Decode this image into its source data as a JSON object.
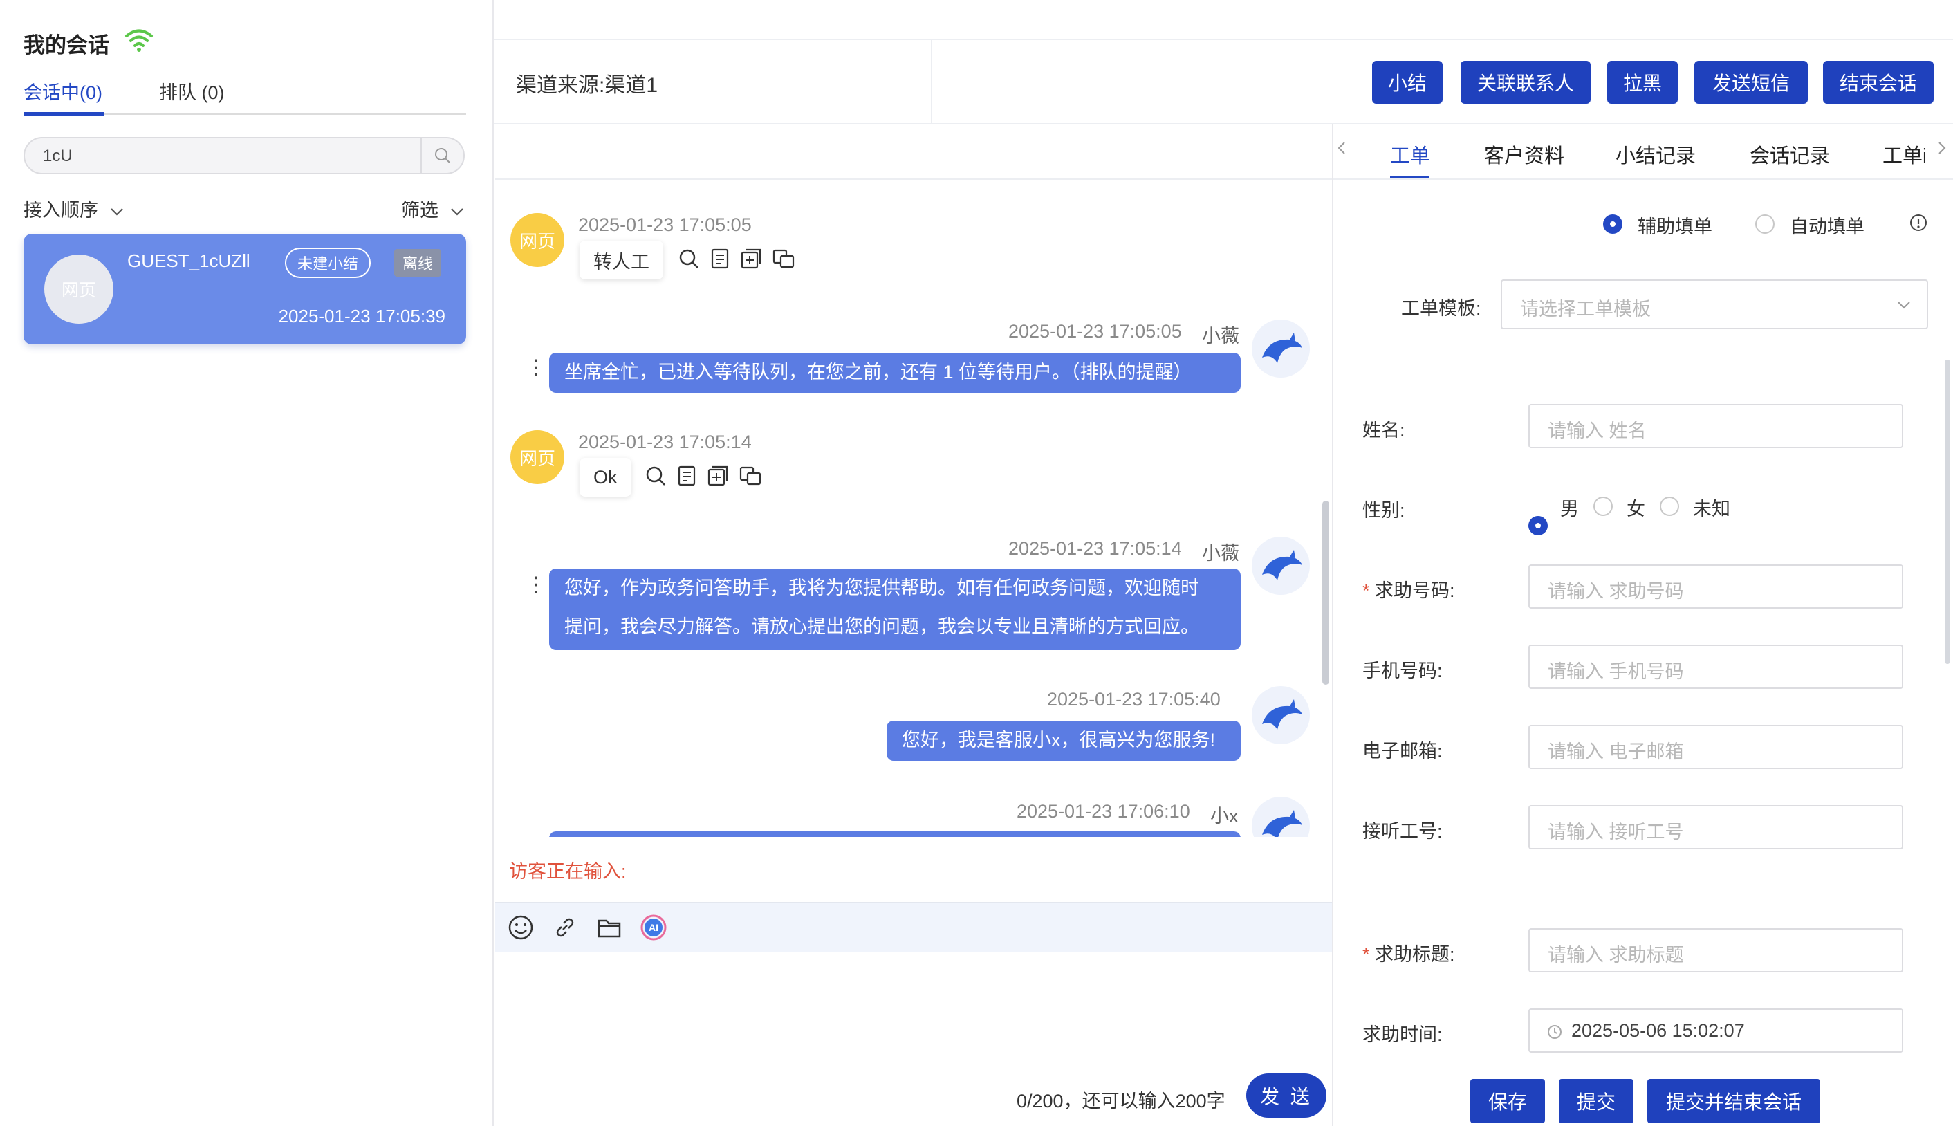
{
  "sidebar": {
    "title": "我的会话",
    "tab_active": "会话中(0)",
    "tab_queue": "排队 (0)",
    "search_value": "1cU",
    "sort_label": "接入顺序",
    "filter_label": "筛选",
    "session": {
      "avatar_text": "网页",
      "name": "GUEST_1cUZll",
      "badge_summary": "未建小结",
      "badge_status": "离线",
      "time": "2025-01-23 17:05:39"
    }
  },
  "header": {
    "channel": "渠道来源:渠道1",
    "buttons": [
      "小结",
      "关联联系人",
      "拉黑",
      "发送短信",
      "结束会话"
    ]
  },
  "chat": {
    "messages": [
      {
        "from": "visitor",
        "avatar": "网页",
        "time": "2025-01-23 17:05:05",
        "text": "转人工"
      },
      {
        "from": "agent",
        "name": "小薇",
        "time": "2025-01-23 17:05:05",
        "lines": [
          "坐席全忙，已进入等待队列，在您之前，还有 1 位等待用户。（排队的提醒）"
        ]
      },
      {
        "from": "visitor",
        "avatar": "网页",
        "time": "2025-01-23 17:05:14",
        "text": "Ok"
      },
      {
        "from": "agent",
        "name": "小薇",
        "time": "2025-01-23 17:05:14",
        "lines": [
          "您好，作为政务问答助手，我将为您提供帮助。如有任何政务问题，欢迎随时",
          "提问，我会尽力解答。请放心提出您的问题，我会以专业且清晰的方式回应。"
        ]
      },
      {
        "from": "agent",
        "name": "",
        "time": "2025-01-23 17:05:40",
        "lines": [
          "您好，我是客服小x，很高兴为您服务!"
        ]
      },
      {
        "from": "agent",
        "name": "小x",
        "time": "2025-01-23 17:06:10",
        "lines": [
          ""
        ]
      }
    ],
    "typing_text": "访客正在输入:",
    "counter": "0/200，还可以输入200字",
    "send_label": "发 送"
  },
  "right": {
    "tabs": [
      "工单",
      "客户资料",
      "小结记录",
      "会话记录",
      "工单i"
    ],
    "mode_assist": "辅助填单",
    "mode_auto": "自动填单",
    "template_label": "工单模板:",
    "template_placeholder": "请选择工单模板",
    "fields": {
      "name_label": "姓名:",
      "name_ph": "请输入 姓名",
      "gender_label": "性别:",
      "gender_male": "男",
      "gender_female": "女",
      "gender_unknown": "未知",
      "help_no_label": "求助号码:",
      "help_no_ph": "请输入 求助号码",
      "phone_label": "手机号码:",
      "phone_ph": "请输入 手机号码",
      "email_label": "电子邮箱:",
      "email_ph": "请输入 电子邮箱",
      "agent_no_label": "接听工号:",
      "agent_no_ph": "请输入 接听工号",
      "help_title_label": "求助标题:",
      "help_title_ph": "请输入 求助标题",
      "help_time_label": "求助时间:",
      "help_time_value": "2025-05-06 15:02:07"
    },
    "actions": [
      "保存",
      "提交",
      "提交并结束会话"
    ]
  },
  "colors": {
    "primary": "#1f41bd",
    "card": "#6a8be8",
    "agent_bubble": "#5b7ce3",
    "visitor_avatar": "#f9cd45",
    "typing": "#e0523c"
  }
}
